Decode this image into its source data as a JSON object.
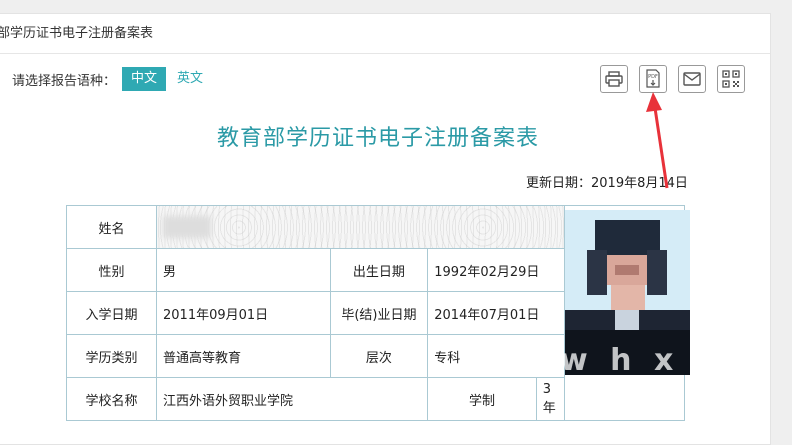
{
  "panel": {
    "title": "部学历证书电子注册备案表"
  },
  "lang": {
    "label": "请选择报告语种：",
    "options": [
      "中文",
      "英文"
    ],
    "selected": "中文"
  },
  "tools": [
    {
      "name": "print-icon"
    },
    {
      "name": "pdf-download-icon",
      "text": "PDF"
    },
    {
      "name": "mail-icon"
    },
    {
      "name": "qrcode-icon"
    }
  ],
  "doc": {
    "title": "教育部学历证书电子注册备案表",
    "update_date": "更新日期：2019年8月14日"
  },
  "record": {
    "name_label": "姓名",
    "gender_label": "性别",
    "gender": "男",
    "birth_label": "出生日期",
    "birth": "1992年02月29日",
    "enroll_label": "入学日期",
    "enroll": "2011年09月01日",
    "grad_label": "毕(结)业日期",
    "grad": "2014年07月01日",
    "type_label": "学历类别",
    "type": "普通高等教育",
    "level_label": "层次",
    "level": "专科",
    "school_label": "学校名称",
    "school": "江西外语外贸职业学院",
    "duration_label": "学制",
    "duration": "3 年"
  },
  "watermark": "w h x n",
  "colors": {
    "accent": "#2fa9b3",
    "title": "#2b9aa6",
    "arrow": "#e8323a"
  }
}
